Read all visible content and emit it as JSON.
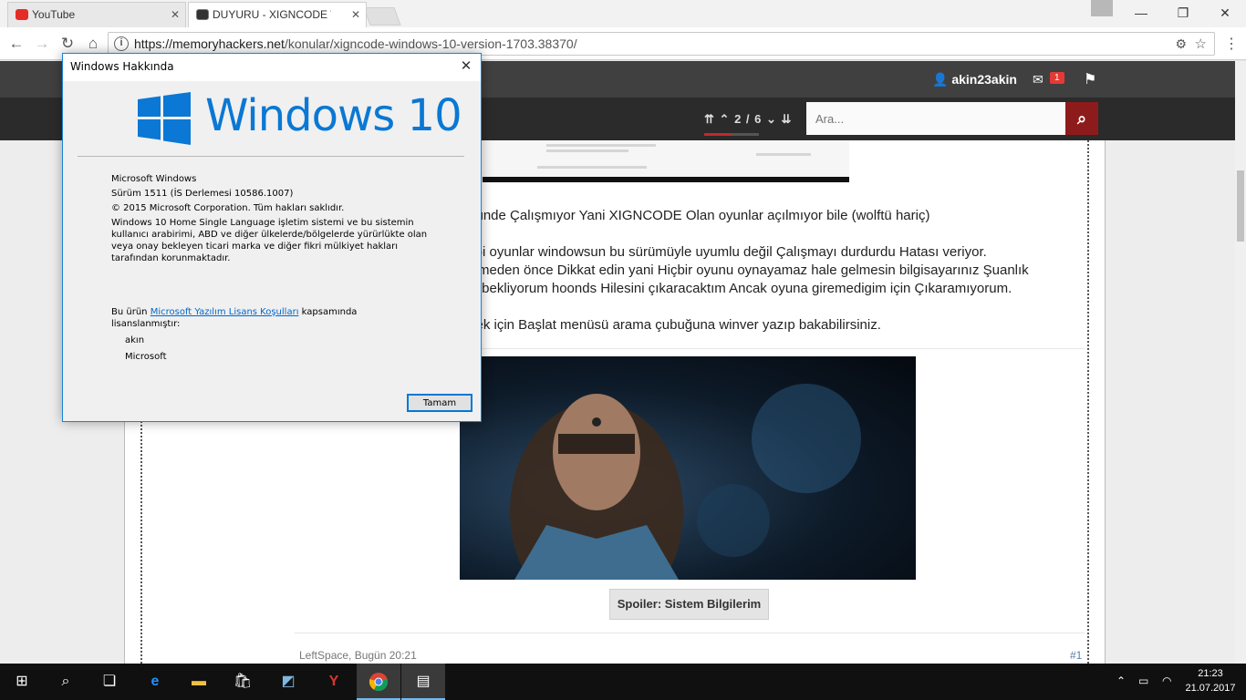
{
  "browser": {
    "tabs": [
      {
        "title": "YouTube",
        "icon": "youtube-icon",
        "active": false
      },
      {
        "title": "DUYURU - XIGNCODE W",
        "icon": "memoryhackers-icon",
        "active": true
      }
    ],
    "url_host": "https://memoryhackers.net",
    "url_path": "/konular/xigncode-windows-10-version-1703.38370/"
  },
  "site": {
    "username": "akin23akin",
    "message_count": "1",
    "pager": "2 / 6",
    "search_placeholder": "Ara...",
    "post_lines": [
      "münde Çalışmıyor Yani XIGNCODE Olan oyunlar açılmıyor bile (wolftü hariç)",
      "gibi oyunlar windowsun bu sürümüyle uyumlu değil Çalışmayı durdurdu Hatası veriyor.",
      "llemeden önce Dikkat edin yani Hiçbir oyunu oynayamaz hale gelmesin bilgisayarınız Şuanlık",
      "ini bekliyorum hoonds Hilesini çıkaracaktım Ancak oyuna giremedigim için Çıkaramıyorum.",
      "mek için Başlat menüsü arama çubuğuna winver yazıp bakabilirsiniz."
    ],
    "spoiler_label": "Spoiler: Sistem Bilgilerim",
    "post_meta": "LeftSpace, Bugün 20:21",
    "post_number": "#1"
  },
  "dialog": {
    "title": "Windows Hakkında",
    "wordmark": "Windows 10",
    "product": "Microsoft Windows",
    "version": "Sürüm 1511 (İS Derlemesi 10586.1007)",
    "copyright": "© 2015 Microsoft Corporation. Tüm hakları saklıdır.",
    "description": "Windows 10 Home Single Language işletim sistemi ve bu sistemin kullanıcı arabirimi, ABD ve diğer ülkelerde/bölgelerde yürürlükte olan veya onay bekleyen ticari marka ve diğer fikri mülkiyet hakları tarafından korunmaktadır.",
    "license_prefix": "Bu ürün",
    "license_link": "Microsoft Yazılım Lisans Koşulları",
    "license_suffix": "kapsamında lisanslanmıştır:",
    "licensee_user": "akın",
    "licensee_org": "Microsoft",
    "ok_label": "Tamam"
  },
  "taskbar": {
    "time": "21:23",
    "date": "21.07.2017"
  },
  "colors": {
    "windows_blue": "#0a78d4",
    "site_dark": "#2b2b2b",
    "search_button": "#8e1b1b",
    "badge_red": "#e53935"
  }
}
